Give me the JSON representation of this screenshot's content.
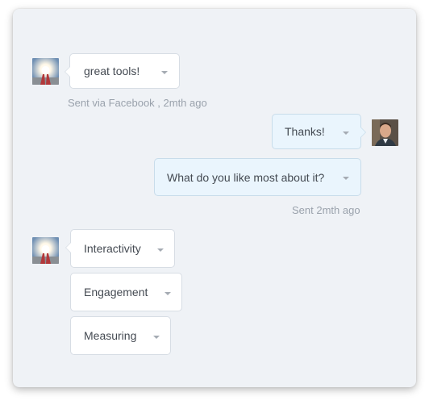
{
  "thread": {
    "incoming_1": {
      "avatar_icon": "person-holding-light-avatar-icon",
      "message": "great tools!",
      "meta": "Sent via Facebook , 2mth ago"
    },
    "outgoing": {
      "avatar_icon": "man-portrait-avatar-icon",
      "messages": [
        "Thanks!",
        "What do you like most about it?"
      ],
      "meta": "Sent 2mth ago"
    },
    "incoming_2": {
      "avatar_icon": "person-holding-light-avatar-icon",
      "options": [
        "Interactivity",
        "Engagement",
        "Measuring"
      ]
    }
  },
  "colors": {
    "panel_bg": "#eff2f6",
    "incoming_bubble": "#ffffff",
    "outgoing_bubble": "#eaf5fd",
    "meta_text": "#9aa2ac"
  }
}
